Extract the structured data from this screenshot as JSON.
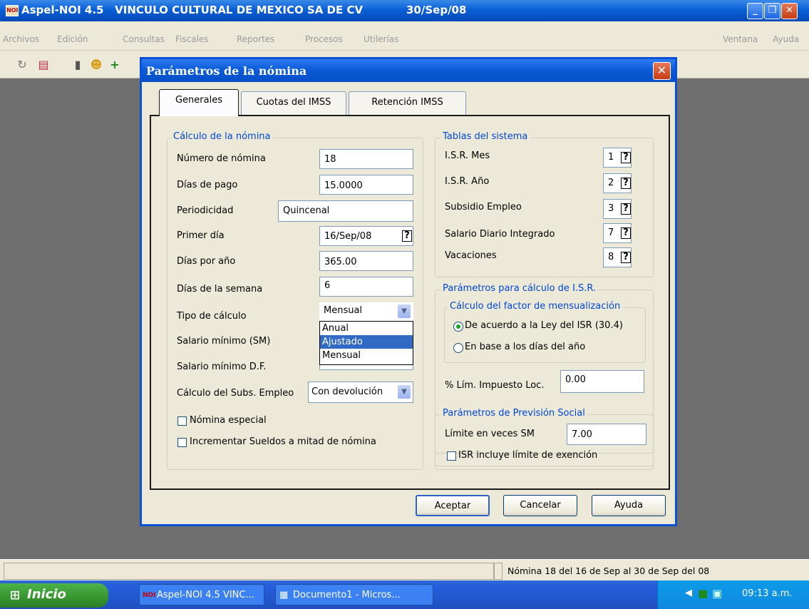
{
  "app": {
    "title": "Aspel-NOI 4.5   VINCULO CULTURAL DE MEXICO SA DE CV",
    "date": "30/Sep/08",
    "logo": "NOI",
    "minimize_icon": "minimize-icon",
    "restore_icon": "restore-icon",
    "close_icon": "close-icon"
  },
  "menu": {
    "items": [
      "Archivos",
      "Edición",
      "Consultas",
      "Fiscales",
      "Reportes",
      "Procesos",
      "Utilerías"
    ],
    "right_items": [
      "Ventana",
      "Ayuda"
    ]
  },
  "toolbar": {
    "icons": [
      "refresh-icon",
      "report-icon",
      "bottle-icon",
      "users-icon",
      "add-icon"
    ]
  },
  "dialog": {
    "title": "Parámetros de la nómina",
    "tabs": [
      "Generales",
      "Cuotas del IMSS",
      "Retención IMSS"
    ],
    "active_tab": "Generales",
    "calculo": {
      "title": "Cálculo de la nómina",
      "numero_nomina_label": "Número de nómina",
      "numero_nomina": "18",
      "dias_pago_label": "Días de pago",
      "dias_pago": "15.0000",
      "periodicidad_label": "Periodicidad",
      "periodicidad": "Quincenal",
      "primer_dia_label": "Primer día",
      "primer_dia": "16/Sep/08",
      "dias_anio_label": "Días por año",
      "dias_anio": "365.00",
      "dias_semana_label": "Días de la semana",
      "dias_semana": "6",
      "tipo_calculo_label": "Tipo de cálculo",
      "tipo_calculo": "Mensual",
      "tipo_calculo_options": [
        "Anual",
        "Ajustado",
        "Mensual"
      ],
      "tipo_calculo_highlight": "Ajustado",
      "salario_minimo_label": "Salario mínimo (SM)",
      "salario_minimo_df_label": "Salario mínimo D.F.",
      "subs_empleo_label": "Cálculo del Subs. Empleo",
      "subs_empleo": "Con devolución",
      "nomina_especial": "Nómina especial",
      "incrementar_sueldos": "Incrementar Sueldos a mitad de nómina"
    },
    "tablas": {
      "title": "Tablas del sistema",
      "rows": [
        {
          "label": "I.S.R. Mes",
          "value": "1"
        },
        {
          "label": "I.S.R. Año",
          "value": "2"
        },
        {
          "label": "Subsidio Empleo",
          "value": "3"
        },
        {
          "label": "Salario Diario Integrado",
          "value": "7"
        },
        {
          "label": "Vacaciones",
          "value": "8"
        }
      ],
      "help_glyph": "?"
    },
    "isr": {
      "title": "Parámetros para cálculo de I.S.R.",
      "factor_title": "Cálculo del factor de mensualización",
      "option_ley": "De acuerdo a la Ley del ISR (30.4)",
      "option_dias": "En base a los días del año",
      "lim_impuesto_label": "% Lím. Impuesto Loc.",
      "lim_impuesto": "0.00"
    },
    "prevision": {
      "title": "Parámetros de Previsión Social",
      "limite_label": "Límite en veces SM",
      "limite": "7.00",
      "isr_incluye": "ISR incluye límite de exención"
    },
    "buttons": {
      "aceptar": "Aceptar",
      "cancelar": "Cancelar",
      "ayuda": "Ayuda"
    }
  },
  "status": {
    "text": "Nómina 18 del 16 de Sep al 30 de Sep del 08"
  },
  "taskbar": {
    "start": "Inicio",
    "tasks": [
      "Aspel-NOI 4.5  VINC...",
      "Documento1 - Micros..."
    ],
    "clock": "09:13 a.m."
  }
}
